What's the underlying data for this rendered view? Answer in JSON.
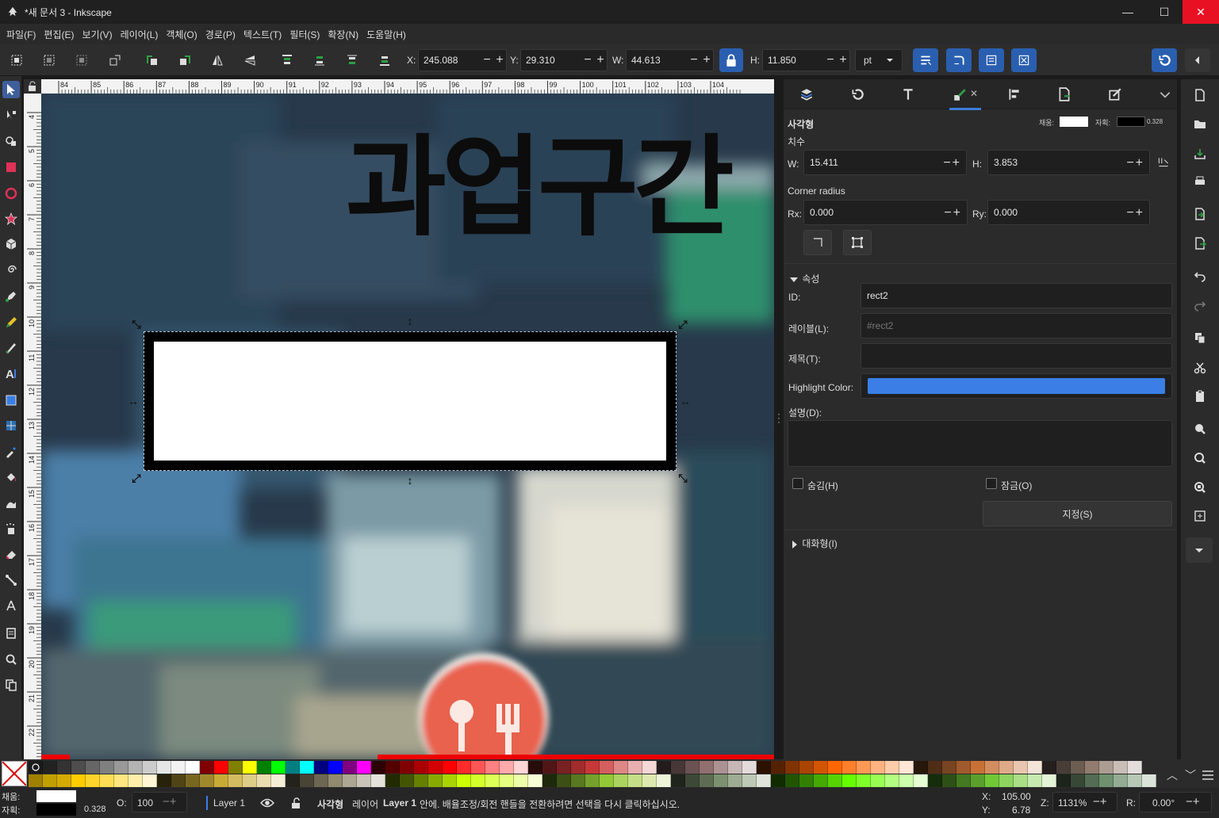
{
  "window": {
    "title": "*새 문서 3 - Inkscape",
    "minimize": "—",
    "maximize": "☐",
    "close": "✕"
  },
  "menu": [
    "파일(F)",
    "편집(E)",
    "보기(V)",
    "레이어(L)",
    "객체(O)",
    "경로(P)",
    "텍스트(T)",
    "필터(S)",
    "확장(N)",
    "도움말(H)"
  ],
  "toolbar": {
    "x_label": "X:",
    "x_value": "245.088",
    "y_label": "Y:",
    "y_value": "29.310",
    "w_label": "W:",
    "w_value": "44.613",
    "h_label": "H:",
    "h_value": "11.850",
    "unit": "pt"
  },
  "rulers": {
    "h_ticks": [
      "84",
      "85",
      "86",
      "87",
      "88",
      "89",
      "90",
      "91",
      "92",
      "93",
      "94",
      "95",
      "96",
      "97",
      "98",
      "99",
      "100",
      "101",
      "102",
      "103",
      "104"
    ],
    "v_ticks": [
      "4",
      "5",
      "6",
      "7",
      "8",
      "9",
      "10",
      "11",
      "12",
      "13",
      "14",
      "15",
      "16",
      "17",
      "18",
      "19",
      "20",
      "21",
      "22"
    ]
  },
  "canvas": {
    "headline": "과업구간"
  },
  "panel": {
    "object_type": "사각형",
    "fill_label": "채움:",
    "stroke_label": "자획:",
    "stroke_width": "0.328",
    "dimensions_label": "치수",
    "w_label": "W:",
    "w_value": "15.411",
    "h_label": "H:",
    "h_value": "3.853",
    "corner_radius_label": "Corner radius",
    "rx_label": "Rx:",
    "rx_value": "0.000",
    "ry_label": "Ry:",
    "ry_value": "0.000",
    "properties_label": "속성",
    "id_label": "ID:",
    "id_value": "rect2",
    "label_label": "레이블(L):",
    "label_placeholder": "#rect2",
    "title_label": "제목(T):",
    "title_value": "",
    "highlight_label": "Highlight Color:",
    "highlight_color": "#3b7ee6",
    "desc_label": "설명(D):",
    "hide_label": "숨김(H)",
    "lock_label": "잠금(O)",
    "set_button": "지정(S)",
    "interactive_label": "대화형(I)"
  },
  "status": {
    "fill_label": "채움:",
    "stroke_label": "자획:",
    "stroke_width": "0.328",
    "opacity_label": "O:",
    "opacity_value": "100",
    "layer_name": "Layer 1",
    "msg_type": "사각형",
    "msg_pre": "레이어",
    "msg_layer": "Layer 1",
    "msg_post": "안에. 배율조정/회전 핸들을 전환하려면 선택을 다시 클릭하십시오.",
    "cursor_x_label": "X:",
    "cursor_x": "105.00",
    "cursor_y_label": "Y:",
    "cursor_y": "6.78",
    "zoom_label": "Z:",
    "zoom_value": "1131%",
    "rotate_label": "R:",
    "rotate_value": "0.00°"
  },
  "palette_row1": [
    "#222222",
    "#333333",
    "#4d4d4d",
    "#666666",
    "#808080",
    "#999999",
    "#b3b3b3",
    "#cccccc",
    "#e6e6e6",
    "#f2f2f2",
    "#ffffff",
    "#800000",
    "#ff0000",
    "#808000",
    "#ffff00",
    "#008000",
    "#00ff00",
    "#008080",
    "#00ffff",
    "#000080",
    "#0000ff",
    "#800080",
    "#ff00ff",
    "#2b0000",
    "#550000",
    "#800000",
    "#aa0000",
    "#d40000",
    "#ff0000",
    "#ff2a2a",
    "#ff5555",
    "#ff8080",
    "#ffaaaa",
    "#ffd5d5",
    "#280b0b",
    "#501616",
    "#782121",
    "#a02c2c",
    "#c83737",
    "#d35f5f",
    "#de8787",
    "#e9afaf",
    "#f4d7d7",
    "#241c1c",
    "#483737",
    "#6c5353",
    "#916f6f",
    "#ac9393",
    "#c8b7b7",
    "#e3dbdb",
    "#2b1100",
    "#552200",
    "#803300",
    "#aa4400",
    "#d45500",
    "#ff6600",
    "#ff7f2a",
    "#ff9955",
    "#ffb380",
    "#ffccaa",
    "#ffe6d5",
    "#28170b",
    "#502d16",
    "#784421",
    "#a05a2c",
    "#c87137",
    "#d38d5f",
    "#deaa87",
    "#e9c6af",
    "#f4e3d7",
    "#241f1c",
    "#483e37",
    "#6c5d53",
    "#917c6f",
    "#ac9d93",
    "#c8beb7",
    "#e3dedb"
  ],
  "palette_row2": [
    "#a08000",
    "#c0a000",
    "#d4aa00",
    "#ffcc00",
    "#ffd42a",
    "#ffdd55",
    "#ffe680",
    "#ffeeaa",
    "#fff6d5",
    "#28220b",
    "#504416",
    "#786721",
    "#a0892c",
    "#c8ab37",
    "#d3bc5f",
    "#decd87",
    "#e9ddaf",
    "#f4eed7",
    "#24221c",
    "#484537",
    "#6c6753",
    "#918a6f",
    "#aca793",
    "#c8c4b7",
    "#e3e2db",
    "#222b00",
    "#445500",
    "#668000",
    "#88aa00",
    "#aad400",
    "#ccff00",
    "#d4ff2a",
    "#ddff55",
    "#e5ff80",
    "#eeffaa",
    "#f6ffd5",
    "#1e280b",
    "#3c5016",
    "#597821",
    "#76a02c",
    "#93c837",
    "#abd35f",
    "#c4de87",
    "#dde9af",
    "#eef4d7",
    "#1f241c",
    "#3e4837",
    "#5d6c53",
    "#7c916f",
    "#9dac93",
    "#bec8b7",
    "#dee3db",
    "#112b00",
    "#225500",
    "#338000",
    "#44aa00",
    "#55d400",
    "#66ff00",
    "#7fff2a",
    "#99ff55",
    "#b3ff80",
    "#ccffaa",
    "#e5ffd5",
    "#162d0b",
    "#2d5016",
    "#447821",
    "#5aa02c",
    "#71c837",
    "#8dd35f",
    "#aade87",
    "#c6e9af",
    "#e3f4d7",
    "#1c241c",
    "#374837",
    "#536c53",
    "#6f916f",
    "#93ac93",
    "#b7c8b7",
    "#dbe3db"
  ]
}
